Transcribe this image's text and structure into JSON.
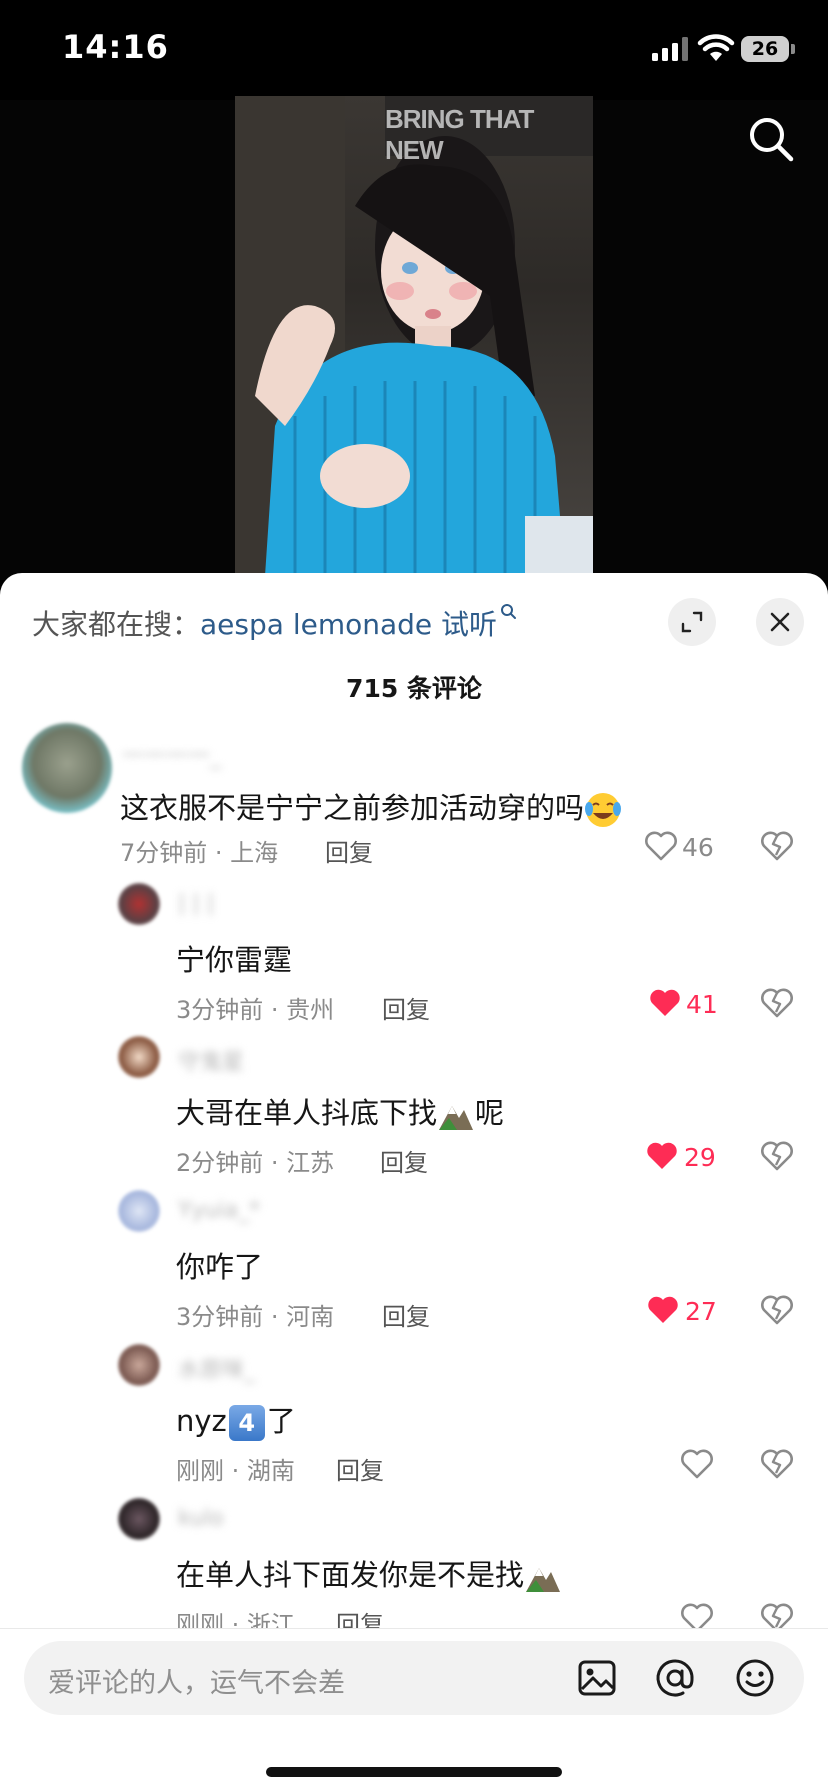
{
  "status": {
    "time": "14:16",
    "battery": "26"
  },
  "video": {
    "poster_text": "BRING THAT NEW\nALL THE W"
  },
  "sheet": {
    "hot_search_label": "大家都在搜：",
    "hot_search_term": "aespa lemonade 试听",
    "comment_count": "715 条评论"
  },
  "comments": [
    {
      "text": "这衣服不是宁宁之前参加活动穿的吗",
      "meta": "7分钟前 · 上海",
      "reply": "回复",
      "likes": "46",
      "liked": false
    },
    {
      "text": "宁你雷霆",
      "meta": "3分钟前 · 贵州",
      "reply": "回复",
      "likes": "41",
      "liked": true
    },
    {
      "text": "大哥在单人抖底下找",
      "text_tail": "呢",
      "meta": "2分钟前 · 江苏",
      "reply": "回复",
      "likes": "29",
      "liked": true
    },
    {
      "text": "你咋了",
      "meta": "3分钟前 · 河南",
      "reply": "回复",
      "likes": "27",
      "liked": true
    },
    {
      "text": "nyz",
      "text_tail": "了",
      "meta": "刚刚 · 湖南",
      "reply": "回复",
      "likes": "",
      "liked": false
    },
    {
      "text": "在单人抖下面发你是不是找",
      "meta": "刚刚 · 浙江",
      "reply": "回复",
      "likes": "",
      "liked": false
    }
  ],
  "usernames": [
    "一一一一_",
    "| | |",
    "守鬼星",
    "Yyuia_*",
    "水原咪_",
    "kulo"
  ],
  "emoji_keycap": "4",
  "input": {
    "placeholder": "爱评论的人，运气不会差"
  },
  "colors": {
    "liked": "#fe2c55",
    "link": "#2d5b8a",
    "muted": "#8a8a8a"
  },
  "icons": [
    "search-icon",
    "expand-icon",
    "close-icon",
    "heart-icon",
    "broken-heart-icon",
    "image-icon",
    "at-icon",
    "smiley-icon"
  ]
}
